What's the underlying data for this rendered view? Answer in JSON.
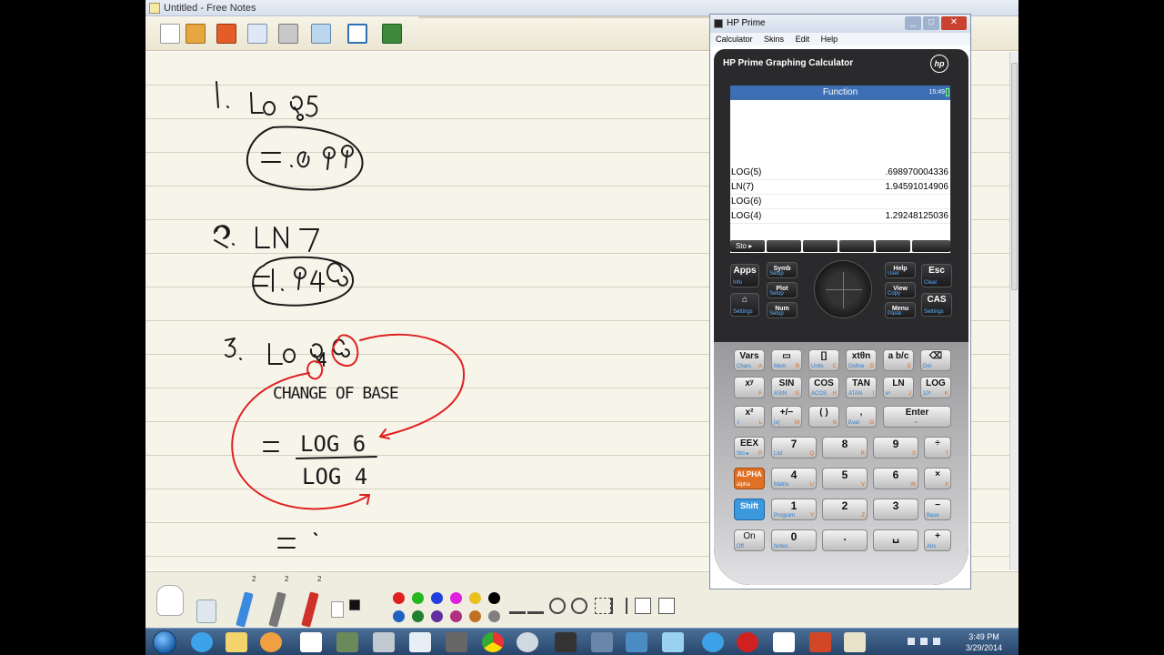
{
  "free_notes": {
    "title": "Untitled - Free Notes",
    "palette_sizes": [
      "2",
      "2",
      "2"
    ],
    "colors": [
      "#e02020",
      "#22b822",
      "#2040e0",
      "#e020e0",
      "#e8c020",
      "#000000",
      "#2060c0",
      "#208030",
      "#6030a0",
      "#b03080",
      "#c07020",
      "#808080"
    ]
  },
  "hp_window": {
    "title": "HP Prime",
    "menu": [
      "Calculator",
      "Skins",
      "Edit",
      "Help"
    ],
    "brand": "HP Prime Graphing Calculator",
    "logo": "hp"
  },
  "screen": {
    "header": "Function",
    "time": "15:49",
    "history": [
      {
        "expr": "LOG(5)",
        "result": ".698970004336"
      },
      {
        "expr": "LN(7)",
        "result": "1.94591014906"
      },
      {
        "expr": "LOG(6)",
        "result": ""
      },
      {
        "expr": "LOG(4)",
        "result": "1.29248125036"
      }
    ],
    "softkeys": [
      "Sto ▸",
      "",
      "",
      "",
      "",
      ""
    ]
  },
  "keypad": {
    "top_left": [
      {
        "main": "Apps",
        "sub": "Info"
      },
      {
        "main": "Symb",
        "sub": "Setup"
      },
      {
        "main": "Plot",
        "sub": "Setup"
      },
      {
        "main": "Num",
        "sub": "Setup"
      },
      {
        "main": "",
        "sub": "Settings"
      }
    ],
    "top_right": [
      {
        "main": "Help",
        "sub": "User"
      },
      {
        "main": "Esc",
        "sub": "Clear"
      },
      {
        "main": "View",
        "sub": "Copy"
      },
      {
        "main": "CAS",
        "sub": "Settings"
      },
      {
        "main": "Menu",
        "sub": "Paste"
      }
    ],
    "rows": [
      [
        {
          "main": "Vars",
          "sub": "Chars",
          "alpha": "A"
        },
        {
          "main": "▭",
          "sub": "Mem",
          "alpha": "B"
        },
        {
          "main": "[]",
          "sub": "Units",
          "alpha": "C"
        },
        {
          "main": "xtθn",
          "sub": "Define",
          "alpha": "D"
        },
        {
          "main": "a b/c",
          "sub": "",
          "alpha": "E"
        },
        {
          "main": "⌫",
          "sub": "Del",
          "alpha": ""
        }
      ],
      [
        {
          "main": "xʸ",
          "sub": "",
          "alpha": "F"
        },
        {
          "main": "SIN",
          "sub": "ASIN",
          "alpha": "G"
        },
        {
          "main": "COS",
          "sub": "ACOS",
          "alpha": "H"
        },
        {
          "main": "TAN",
          "sub": "ATAN",
          "alpha": "I"
        },
        {
          "main": "LN",
          "sub": "eˣ",
          "alpha": "J"
        },
        {
          "main": "LOG",
          "sub": "10ˣ",
          "alpha": "K"
        }
      ],
      [
        {
          "main": "x²",
          "sub": "√",
          "alpha": "L"
        },
        {
          "main": "+/−",
          "sub": "|x|",
          "alpha": "M"
        },
        {
          "main": "( )",
          "sub": "",
          "alpha": "N"
        },
        {
          "main": ",",
          "sub": "Eval",
          "alpha": "O"
        },
        {
          "main": "Enter",
          "sub": "≈",
          "alpha": ""
        }
      ],
      [
        {
          "main": "EEX",
          "sub": "Sto ▸",
          "alpha": "P"
        },
        {
          "main": "7",
          "sub": "List",
          "alpha": "Q"
        },
        {
          "main": "8",
          "sub": "",
          "alpha": "R"
        },
        {
          "main": "9",
          "sub": "",
          "alpha": "S"
        },
        {
          "main": "÷",
          "sub": "",
          "alpha": "T"
        }
      ],
      [
        {
          "main": "ALPHA",
          "sub": "alpha",
          "alpha": ""
        },
        {
          "main": "4",
          "sub": "Matrix",
          "alpha": "U"
        },
        {
          "main": "5",
          "sub": "",
          "alpha": "V"
        },
        {
          "main": "6",
          "sub": "",
          "alpha": "W"
        },
        {
          "main": "×",
          "sub": "",
          "alpha": "X"
        }
      ],
      [
        {
          "main": "Shift",
          "sub": "",
          "alpha": ""
        },
        {
          "main": "1",
          "sub": "Program",
          "alpha": "Y"
        },
        {
          "main": "2",
          "sub": "",
          "alpha": "Z"
        },
        {
          "main": "3",
          "sub": "",
          "alpha": ""
        },
        {
          "main": "−",
          "sub": "Base",
          "alpha": ""
        }
      ],
      [
        {
          "main": "On",
          "sub": "Off",
          "alpha": ""
        },
        {
          "main": "0",
          "sub": "Notes",
          "alpha": ""
        },
        {
          "main": ".",
          "sub": "",
          "alpha": ""
        },
        {
          "main": "␣",
          "sub": "",
          "alpha": ""
        },
        {
          "main": "+",
          "sub": "Ans",
          "alpha": ""
        }
      ]
    ]
  },
  "taskbar": {
    "time": "3:49 PM",
    "date": "3/29/2014"
  }
}
